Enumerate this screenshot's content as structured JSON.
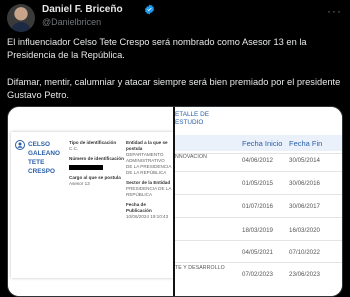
{
  "author": {
    "name": "Daniel F. Briceño",
    "handle": "@Danielbricen",
    "more_label": "···"
  },
  "tweet": {
    "paragraph1": "El influenciador Celso Tete Crespo será nombrado como Asesor 13 en la Presidencia de la República.",
    "paragraph2": "Difamar, mentir, calumniar y atacar siempre será bien premiado por el presidente Gustavo Petro."
  },
  "profile": {
    "name_lines": [
      "CELSO",
      "GALEANO",
      "TETE",
      "CRESPO"
    ],
    "id_type_label": "Tipo de identificación",
    "id_type_value": "C.C.",
    "id_number_label": "Número de identificación",
    "position_label": "Cargo al que se postula",
    "position_value": "Asesor 13",
    "entity_label": "Entidad a la que se postula",
    "entity_value": "DEPARTAMENTO ADMINISTRATIVO DE LA PRESIDENCIA DE LA REPÚBLICA",
    "sector_label": "Sector de la Entidad",
    "sector_value": "PRESIDENCIA DE LA REPÚBLICA",
    "pubdate_label": "Fecha de Publicación",
    "pubdate_value": "10/06/2024 19:10:43"
  },
  "history": {
    "title_line1": "ETALLE DE",
    "title_line2": "ESTUDIO",
    "col_start": "Fecha Inicio",
    "col_end": "Fecha Fin",
    "rows": [
      {
        "desc": "NNOVACION",
        "start": "04/06/2012",
        "end": "30/05/2014"
      },
      {
        "desc": "",
        "start": "01/05/2015",
        "end": "30/06/2016"
      },
      {
        "desc": "",
        "start": "01/07/2016",
        "end": "30/06/2017"
      },
      {
        "desc": "",
        "start": "18/03/2019",
        "end": "16/03/2020"
      },
      {
        "desc": "",
        "start": "04/05/2021",
        "end": "07/10/2022"
      },
      {
        "desc": "TE Y DESARROLLO",
        "start": "07/02/2023",
        "end": "23/06/2023"
      }
    ]
  },
  "colors": {
    "background": "#000000",
    "text": "#e7e9ea",
    "muted": "#71767b",
    "verified": "#1d9bf0",
    "link_blue": "#2a5fa8"
  }
}
